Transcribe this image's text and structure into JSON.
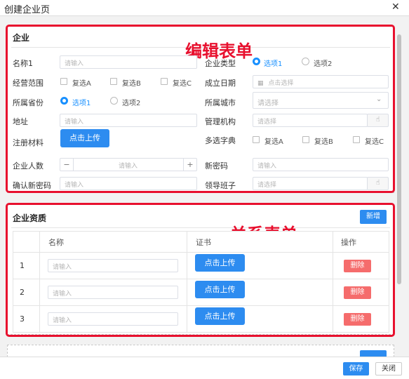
{
  "window": {
    "title": "创建企业页",
    "close_glyph": "✕"
  },
  "form": {
    "section_title": "企业",
    "annotation": "编辑表单",
    "fields": {
      "name": {
        "label": "名称1",
        "placeholder": "请输入"
      },
      "type": {
        "label": "企业类型",
        "options": [
          "选项1",
          "选项2"
        ],
        "selected": "选项1"
      },
      "scope": {
        "label": "经营范围",
        "options": [
          "复选A",
          "复选B",
          "复选C"
        ]
      },
      "founded": {
        "label": "成立日期",
        "placeholder": "点击选择"
      },
      "province": {
        "label": "所属省份",
        "options": [
          "选项1",
          "选项2"
        ],
        "selected": "选项1"
      },
      "city": {
        "label": "所属城市",
        "placeholder": "请选择"
      },
      "address": {
        "label": "地址",
        "placeholder": "请输入"
      },
      "org": {
        "label": "管理机构",
        "placeholder": "请选择"
      },
      "materials": {
        "label": "注册材料",
        "button": "点击上传"
      },
      "dict": {
        "label": "多选字典",
        "options": [
          "复选A",
          "复选B",
          "复选C"
        ]
      },
      "employees": {
        "label": "企业人数",
        "placeholder": "请输入",
        "minus": "−",
        "plus": "+"
      },
      "new_password": {
        "label": "新密码",
        "placeholder": "请输入"
      },
      "confirm_password": {
        "label": "确认新密码",
        "placeholder": "请输入"
      },
      "leaders": {
        "label": "领导班子",
        "placeholder": "请选择"
      }
    }
  },
  "qualifications": {
    "section_title": "企业资质",
    "annotation": "关系表单",
    "add_button": "新增",
    "columns": [
      "名称",
      "证书",
      "操作"
    ],
    "rows": [
      {
        "index": "1",
        "name_placeholder": "请输入",
        "upload": "点击上传",
        "delete": "删除"
      },
      {
        "index": "2",
        "name_placeholder": "请输入",
        "upload": "点击上传",
        "delete": "删除"
      },
      {
        "index": "3",
        "name_placeholder": "请输入",
        "upload": "点击上传",
        "delete": "删除"
      }
    ]
  },
  "footer": {
    "save": "保存",
    "close": "关闭"
  },
  "colors": {
    "accent": "#2d8cf0",
    "danger": "#f56c6c",
    "annotation": "#e8102e"
  }
}
